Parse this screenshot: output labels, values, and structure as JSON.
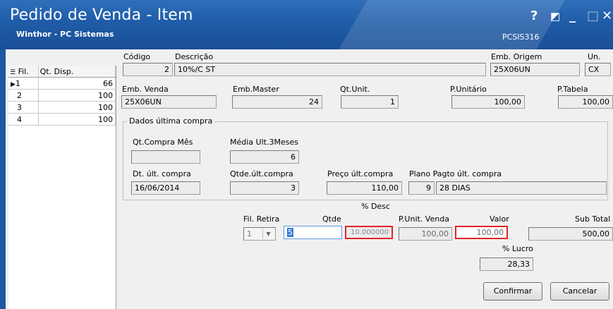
{
  "window": {
    "title": "Pedido de Venda - Item",
    "subtitle": "Winthor - PC Sistemas",
    "screen_code": "PCSIS316",
    "help_label": "?",
    "restore_label": "◩",
    "minimize_label": "_",
    "maximize_label": "□",
    "close_label": "✕"
  },
  "stock_grid": {
    "headers": [
      "Fil.",
      "Qt. Disp."
    ],
    "rows": [
      {
        "fil": "1",
        "qt": "66",
        "selected": true
      },
      {
        "fil": "2",
        "qt": "100"
      },
      {
        "fil": "3",
        "qt": "100"
      },
      {
        "fil": "4",
        "qt": "100"
      }
    ]
  },
  "item": {
    "codigo_label": "Código",
    "codigo": "2",
    "descricao_label": "Descrição",
    "descricao": "10%/C ST",
    "emb_origem_label": "Emb. Origem",
    "emb_origem": "25X06UN",
    "un_label": "Un.",
    "un": "CX",
    "emb_venda_label": "Emb. Venda",
    "emb_venda": "25X06UN",
    "emb_master_label": "Emb.Master",
    "emb_master": "24",
    "qt_unit_label": "Qt.Unit.",
    "qt_unit": "1",
    "p_unitario_label": "P.Unitário",
    "p_unitario": "100,00",
    "p_tabela_label": "P.Tabela",
    "p_tabela": "100,00"
  },
  "last_purchase": {
    "title": "Dados última compra",
    "qt_compra_mes_label": "Qt.Compra Mês",
    "qt_compra_mes": "",
    "media_label": "Média Ult.3Meses",
    "media": "6",
    "dt_label": "Dt. últ. compra",
    "dt": "16/06/2014",
    "qtde_label": "Qtde.últ.compra",
    "qtde": "3",
    "preco_label": "Preço últ.compra",
    "preco": "110,00",
    "plano_label": "Plano Pagto últ. compra",
    "plano_codigo": "9",
    "plano_descricao": "28 DIAS"
  },
  "order": {
    "desc_label": "% Desc",
    "fil_retira_label": "Fil. Retira",
    "fil_retira": "1",
    "qtde_label": "Qtde",
    "qtde": "5",
    "desc": "10.000000",
    "p_unit_venda_label": "P.Unit. Venda",
    "p_unit_venda": "100,00",
    "valor_label": "Valor",
    "valor": "100,00",
    "sub_total_label": "Sub Total",
    "sub_total": "500,00",
    "lucro_label": "% Lucro",
    "lucro": "28,33"
  },
  "buttons": {
    "confirmar": "Confirmar",
    "cancelar": "Cancelar"
  },
  "colors": {
    "title_bar": "#1f5ca8",
    "highlight_border": "#e0252b"
  }
}
